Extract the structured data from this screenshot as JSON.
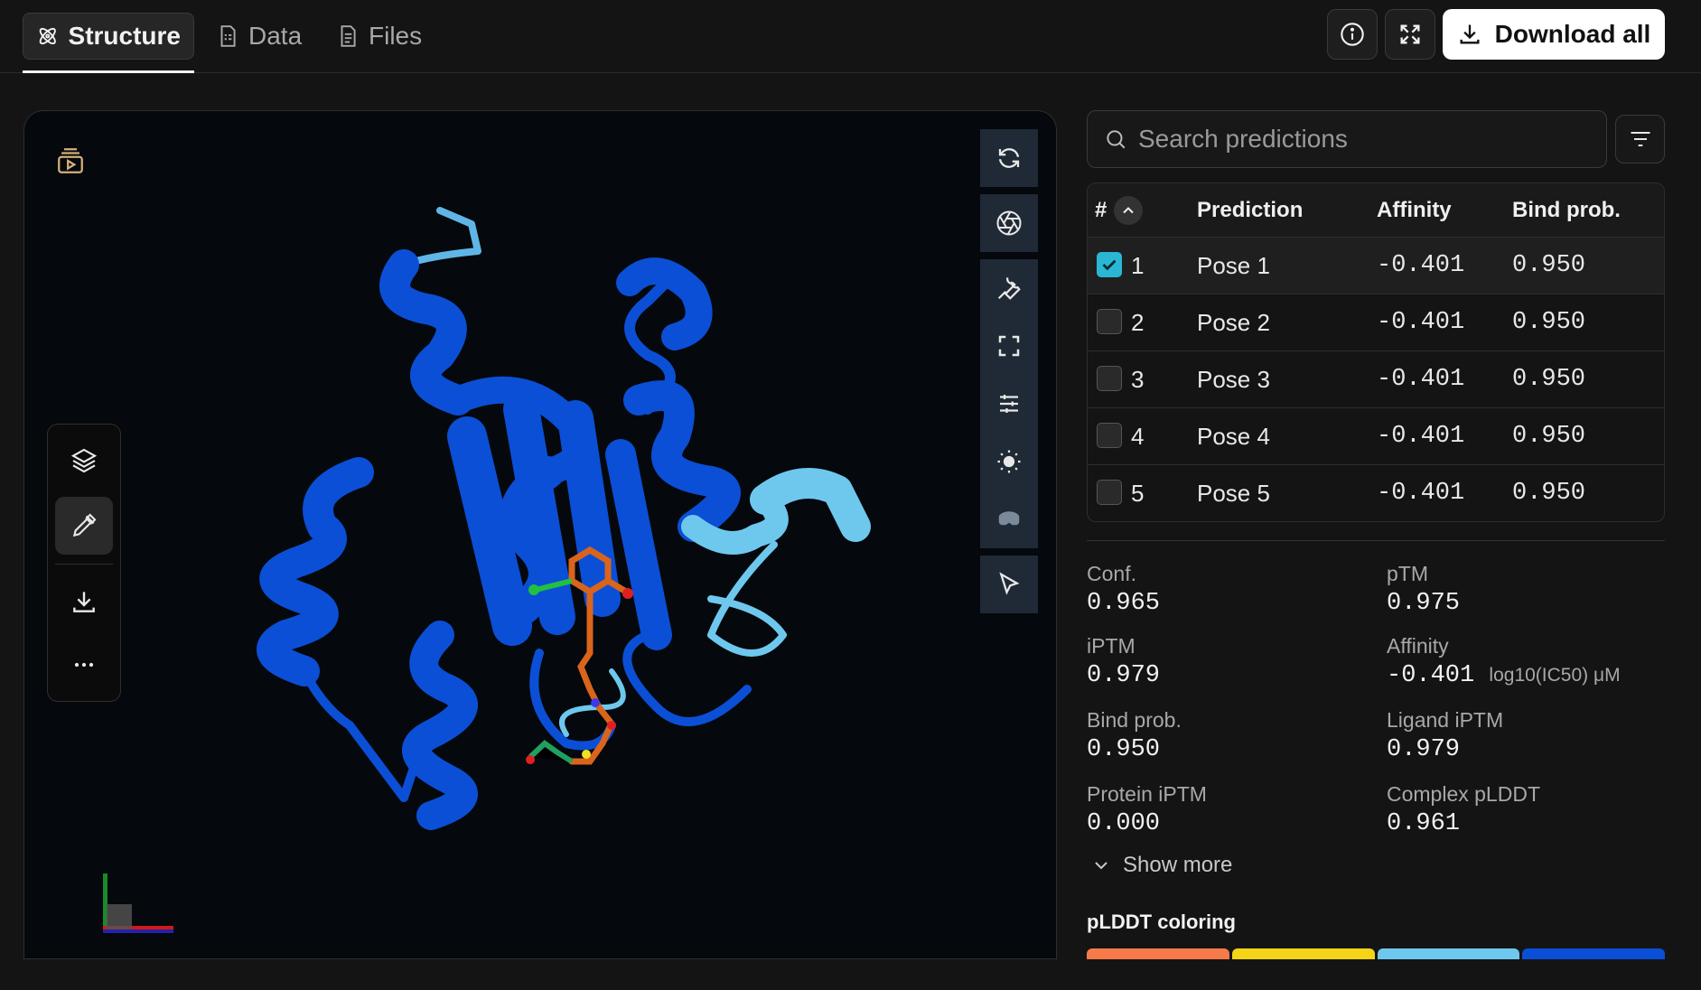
{
  "tabs": [
    {
      "label": "Structure",
      "icon": "atom-icon",
      "active": true
    },
    {
      "label": "Data",
      "icon": "document-icon",
      "active": false
    },
    {
      "label": "Files",
      "icon": "file-icon",
      "active": false
    }
  ],
  "header": {
    "download_all_label": "Download all"
  },
  "search": {
    "placeholder": "Search predictions"
  },
  "table": {
    "headers": {
      "index": "#",
      "prediction": "Prediction",
      "affinity": "Affinity",
      "bind_prob": "Bind prob."
    },
    "rows": [
      {
        "index": "1",
        "prediction": "Pose 1",
        "affinity": "-0.401",
        "bind_prob": "0.950",
        "checked": true
      },
      {
        "index": "2",
        "prediction": "Pose 2",
        "affinity": "-0.401",
        "bind_prob": "0.950",
        "checked": false
      },
      {
        "index": "3",
        "prediction": "Pose 3",
        "affinity": "-0.401",
        "bind_prob": "0.950",
        "checked": false
      },
      {
        "index": "4",
        "prediction": "Pose 4",
        "affinity": "-0.401",
        "bind_prob": "0.950",
        "checked": false
      },
      {
        "index": "5",
        "prediction": "Pose 5",
        "affinity": "-0.401",
        "bind_prob": "0.950",
        "checked": false
      }
    ]
  },
  "metrics": {
    "conf": {
      "label": "Conf.",
      "value": "0.965"
    },
    "ptm": {
      "label": "pTM",
      "value": "0.975"
    },
    "iptm": {
      "label": "iPTM",
      "value": "0.979"
    },
    "affinity": {
      "label": "Affinity",
      "value": "-0.401",
      "unit": "log10(IC50) μM"
    },
    "bind_prob": {
      "label": "Bind prob.",
      "value": "0.950"
    },
    "ligand_iptm": {
      "label": "Ligand iPTM",
      "value": "0.979"
    },
    "protein_iptm": {
      "label": "Protein iPTM",
      "value": "0.000"
    },
    "complex_plddt": {
      "label": "Complex pLDDT",
      "value": "0.961"
    }
  },
  "show_more_label": "Show more",
  "plddt": {
    "title": "pLDDT coloring",
    "colors": [
      "#f77b4a",
      "#f5d417",
      "#6ec8ee",
      "#0b4fd6"
    ]
  },
  "colors": {
    "accent": "#2ab7d4",
    "protein_main": "#0b4fd6",
    "protein_light": "#6ec8ee",
    "ligand": "#d9641c"
  }
}
